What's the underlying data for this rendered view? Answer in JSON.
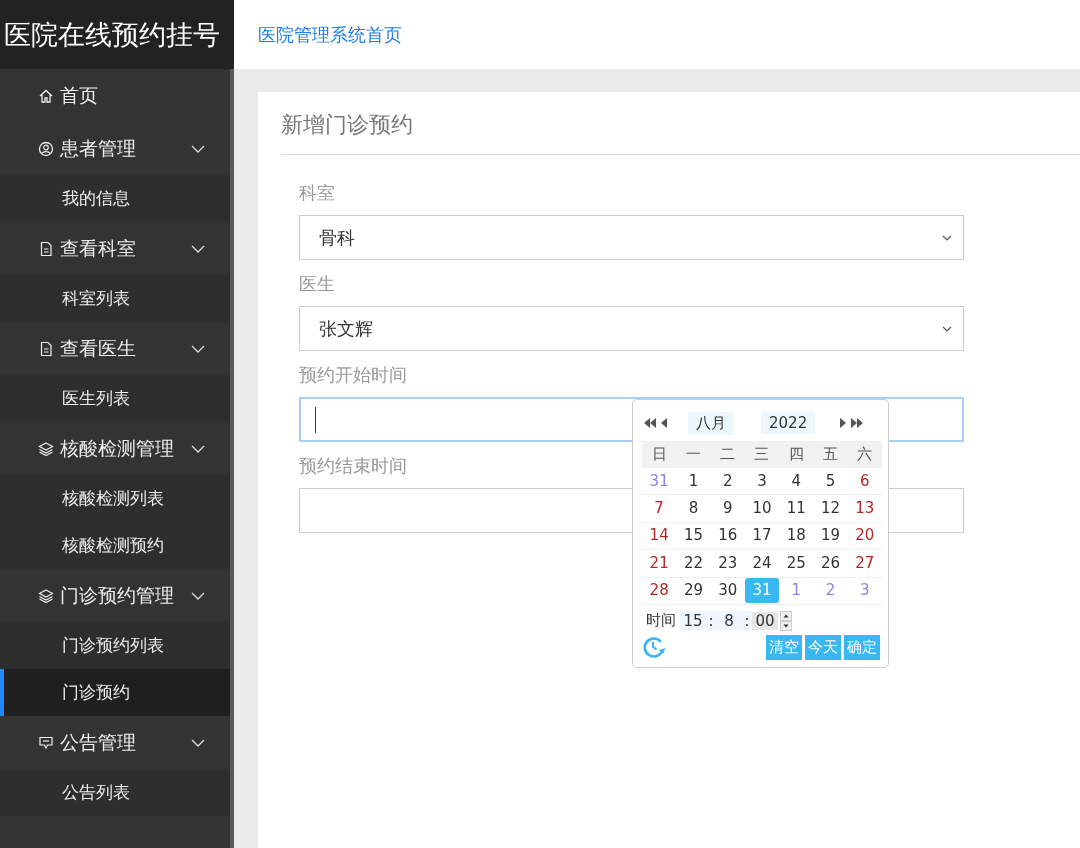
{
  "logo": "医院在线预约挂号",
  "top_link": "医院管理系统首页",
  "sidebar": {
    "items": [
      {
        "label": "首页",
        "selected": false
      },
      {
        "label": "患者管理",
        "selected": false,
        "expanded": true,
        "children": [
          {
            "label": "我的信息",
            "selected": false
          }
        ]
      },
      {
        "label": "查看科室",
        "selected": false,
        "expanded": true,
        "children": [
          {
            "label": "科室列表",
            "selected": false
          }
        ]
      },
      {
        "label": "查看医生",
        "selected": false,
        "expanded": true,
        "children": [
          {
            "label": "医生列表",
            "selected": false
          }
        ]
      },
      {
        "label": "核酸检测管理",
        "selected": false,
        "expanded": true,
        "children": [
          {
            "label": "核酸检测列表",
            "selected": false
          },
          {
            "label": "核酸检测预约",
            "selected": false
          }
        ]
      },
      {
        "label": "门诊预约管理",
        "selected": false,
        "expanded": true,
        "children": [
          {
            "label": "门诊预约列表",
            "selected": false
          },
          {
            "label": "门诊预约",
            "selected": true
          }
        ]
      },
      {
        "label": "公告管理",
        "selected": false,
        "expanded": true,
        "children": [
          {
            "label": "公告列表",
            "selected": false
          }
        ]
      }
    ]
  },
  "card": {
    "title": "新增门诊预约",
    "fields": [
      {
        "label": "科室",
        "kind": "select",
        "value": "骨科"
      },
      {
        "label": "医生",
        "kind": "select",
        "value": "张文辉"
      },
      {
        "label": "预约开始时间",
        "kind": "date",
        "focused": true
      },
      {
        "label": "预约结束时间",
        "kind": "date",
        "focused": false
      }
    ]
  },
  "calendar": {
    "month": "八月",
    "year": "2022",
    "weekdays": [
      "日",
      "一",
      "二",
      "三",
      "四",
      "五",
      "六"
    ],
    "weeks": [
      [
        {
          "day": "31",
          "kind": "other",
          "selected": false
        },
        {
          "day": "1",
          "kind": "normal",
          "selected": false
        },
        {
          "day": "2",
          "kind": "normal",
          "selected": false
        },
        {
          "day": "3",
          "kind": "normal",
          "selected": false
        },
        {
          "day": "4",
          "kind": "normal",
          "selected": false
        },
        {
          "day": "5",
          "kind": "normal",
          "selected": false
        },
        {
          "day": "6",
          "kind": "weekend",
          "selected": false
        }
      ],
      [
        {
          "day": "7",
          "kind": "weekend",
          "selected": false
        },
        {
          "day": "8",
          "kind": "normal",
          "selected": false
        },
        {
          "day": "9",
          "kind": "normal",
          "selected": false
        },
        {
          "day": "10",
          "kind": "normal",
          "selected": false
        },
        {
          "day": "11",
          "kind": "normal",
          "selected": false
        },
        {
          "day": "12",
          "kind": "normal",
          "selected": false
        },
        {
          "day": "13",
          "kind": "weekend",
          "selected": false
        }
      ],
      [
        {
          "day": "14",
          "kind": "weekend",
          "selected": false
        },
        {
          "day": "15",
          "kind": "normal",
          "selected": false
        },
        {
          "day": "16",
          "kind": "normal",
          "selected": false
        },
        {
          "day": "17",
          "kind": "normal",
          "selected": false
        },
        {
          "day": "18",
          "kind": "normal",
          "selected": false
        },
        {
          "day": "19",
          "kind": "normal",
          "selected": false
        },
        {
          "day": "20",
          "kind": "weekend",
          "selected": false
        }
      ],
      [
        {
          "day": "21",
          "kind": "weekend",
          "selected": false
        },
        {
          "day": "22",
          "kind": "normal",
          "selected": false
        },
        {
          "day": "23",
          "kind": "normal",
          "selected": false
        },
        {
          "day": "24",
          "kind": "normal",
          "selected": false
        },
        {
          "day": "25",
          "kind": "normal",
          "selected": false
        },
        {
          "day": "26",
          "kind": "normal",
          "selected": false
        },
        {
          "day": "27",
          "kind": "weekend",
          "selected": false
        }
      ],
      [
        {
          "day": "28",
          "kind": "weekend",
          "selected": false
        },
        {
          "day": "29",
          "kind": "normal",
          "selected": false
        },
        {
          "day": "30",
          "kind": "normal",
          "selected": false
        },
        {
          "day": "31",
          "kind": "normal",
          "selected": true
        },
        {
          "day": "1",
          "kind": "other",
          "selected": false
        },
        {
          "day": "2",
          "kind": "other",
          "selected": false
        },
        {
          "day": "3",
          "kind": "other",
          "selected": false
        }
      ]
    ],
    "time_label": "时间",
    "hour": "15",
    "separator_1": ":",
    "minute": "8",
    "separator_2": ":",
    "second": "00",
    "buttons": [
      "清空",
      "今天",
      "确定"
    ]
  }
}
